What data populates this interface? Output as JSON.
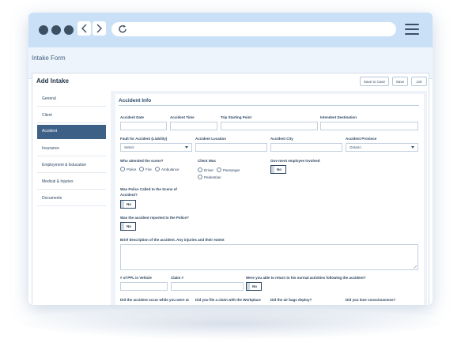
{
  "app": {
    "title": "Intake Form"
  },
  "panel": {
    "title": "Add Intake",
    "buttons": {
      "save_to_case": "Save to Case",
      "save": "Save",
      "list": "List"
    }
  },
  "sidebar": {
    "items": [
      {
        "label": "General"
      },
      {
        "label": "Client"
      },
      {
        "label": "Accident",
        "active": true
      },
      {
        "label": "Insurance"
      },
      {
        "label": "Employment & Education"
      },
      {
        "label": "Medical & Injuries"
      },
      {
        "label": "Documents"
      }
    ]
  },
  "section": {
    "title": "Accident Info",
    "fields": {
      "accident_date": {
        "label": "Accident Date",
        "value": ""
      },
      "accident_time": {
        "label": "Accident Time",
        "value": ""
      },
      "trip_start": {
        "label": "Trip Starting Point",
        "value": ""
      },
      "destination": {
        "label": "Intendent Destination",
        "value": ""
      },
      "fault": {
        "label": "Fault for Accident (Liability)",
        "value": "Select"
      },
      "location": {
        "label": "Accident Location",
        "value": ""
      },
      "city": {
        "label": "Accident City",
        "value": ""
      },
      "province": {
        "label": "Accident Province",
        "value": "Ontario"
      },
      "who_attended": {
        "label": "Who attended the scene?",
        "options": [
          "Police",
          "Fire",
          "Ambulance"
        ]
      },
      "client_was": {
        "label": "Client Was",
        "options": [
          "Driver",
          "Passanger",
          "Pedestrian"
        ]
      },
      "govt_employee": {
        "label": "Gov-ment employee involved",
        "value": "No"
      },
      "police_called": {
        "label_line1": "Was Police Called to the Scene of",
        "label_line2": "Accident?",
        "value": "No"
      },
      "reported": {
        "label": "Was the accident reported to the Police?",
        "value": "No"
      },
      "description": {
        "label": "Brief description of the accident. Any injuries and their extent",
        "value": ""
      },
      "ppl_in_vehicle": {
        "label": "# of PPL in Vehicle",
        "value": ""
      },
      "claim": {
        "label": "Claim #",
        "value": ""
      },
      "return_normal": {
        "label": "Were you able to return to his normal activities following the accident?",
        "value": "No"
      },
      "occur_work": {
        "label": "Did the accident occur while you were at"
      },
      "filed_claim": {
        "label": "Did you file a claim with the Workplace"
      },
      "airbags": {
        "label": "Did the air bags deploy?"
      },
      "consciousness": {
        "label": "Did you lose consciousness?"
      }
    }
  },
  "colors": {
    "chrome": "#c9e0f7",
    "accent": "#3d6087",
    "text": "#23364a"
  }
}
